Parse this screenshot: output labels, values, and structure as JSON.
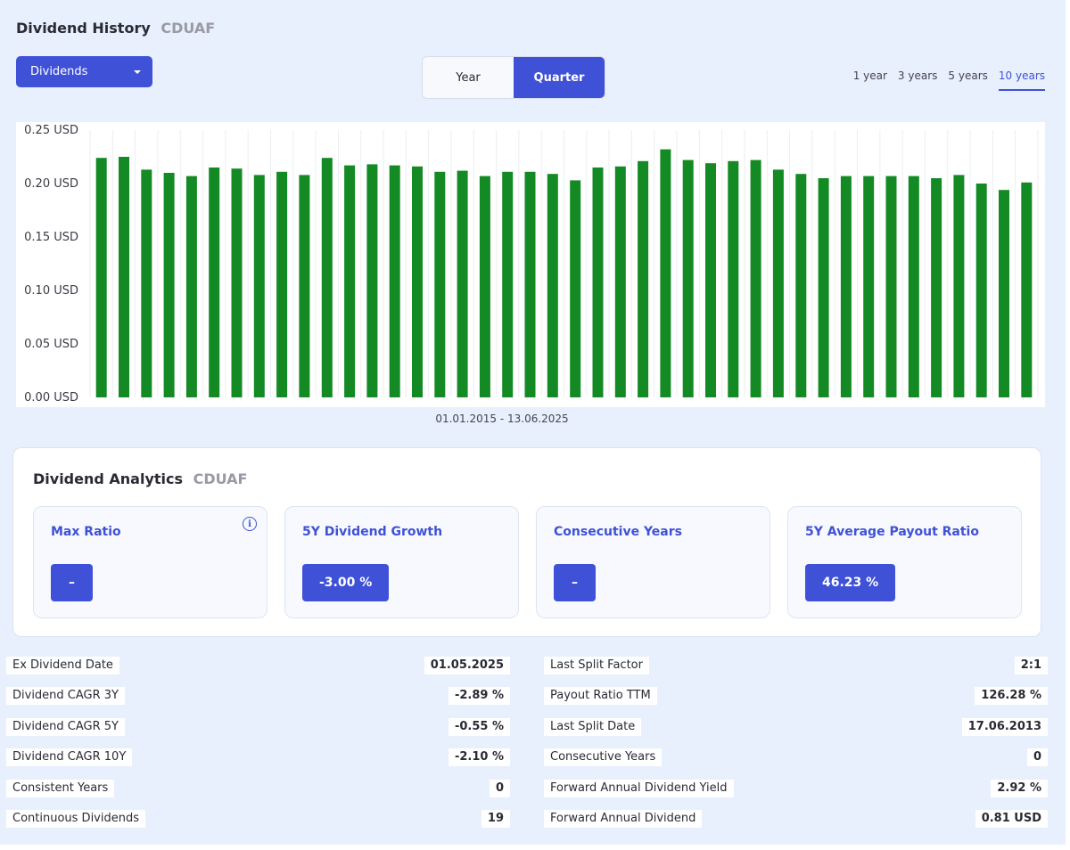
{
  "header": {
    "title": "Dividend History",
    "ticker": "CDUAF",
    "dropdown_value": "Dividends",
    "toggle": {
      "year": "Year",
      "quarter": "Quarter",
      "selected": "Quarter"
    },
    "ranges": [
      "1 year",
      "3 years",
      "5 years",
      "10 years"
    ],
    "active_range": "10 years"
  },
  "chart_data": {
    "type": "bar",
    "title": "",
    "xlabel": "01.01.2015 - 13.06.2025",
    "ylabel": "",
    "ylim": [
      0,
      0.25
    ],
    "yticks": [
      "0.25 USD",
      "0.20 USD",
      "0.15 USD",
      "0.10 USD",
      "0.05 USD",
      "0.00 USD"
    ],
    "ytick_values": [
      0.25,
      0.2,
      0.15,
      0.1,
      0.05,
      0.0
    ],
    "grid": true,
    "color": "#148a24",
    "values": [
      0.224,
      0.225,
      0.213,
      0.21,
      0.207,
      0.215,
      0.214,
      0.208,
      0.211,
      0.208,
      0.224,
      0.217,
      0.218,
      0.217,
      0.216,
      0.211,
      0.212,
      0.207,
      0.211,
      0.211,
      0.209,
      0.203,
      0.215,
      0.216,
      0.221,
      0.232,
      0.222,
      0.219,
      0.221,
      0.222,
      0.213,
      0.209,
      0.205,
      0.207,
      0.207,
      0.207,
      0.207,
      0.205,
      0.208,
      0.2,
      0.194,
      0.201
    ]
  },
  "analytics": {
    "heading": "Dividend Analytics",
    "ticker": "CDUAF",
    "metrics": [
      {
        "label": "Max Ratio",
        "value": "–"
      },
      {
        "label": "5Y Dividend Growth",
        "value": "-3.00 %"
      },
      {
        "label": "Consecutive Years",
        "value": "–"
      },
      {
        "label": "5Y Average Payout Ratio",
        "value": "46.23 %"
      }
    ],
    "info_glyph": "i"
  },
  "stats": {
    "left": [
      {
        "label": "Ex Dividend Date",
        "value": "01.05.2025"
      },
      {
        "label": "Dividend CAGR 3Y",
        "value": "-2.89 %"
      },
      {
        "label": "Dividend CAGR 5Y",
        "value": "-0.55 %"
      },
      {
        "label": "Dividend CAGR 10Y",
        "value": "-2.10 %"
      },
      {
        "label": "Consistent Years",
        "value": "0"
      },
      {
        "label": "Continuous Dividends",
        "value": "19"
      }
    ],
    "right": [
      {
        "label": "Last Split Factor",
        "value": "2:1"
      },
      {
        "label": "Payout Ratio TTM",
        "value": "126.28 %"
      },
      {
        "label": "Last Split Date",
        "value": "17.06.2013"
      },
      {
        "label": "Consecutive Years",
        "value": "0"
      },
      {
        "label": "Forward Annual Dividend Yield",
        "value": "2.92 %"
      },
      {
        "label": "Forward Annual Dividend",
        "value": "0.81 USD"
      }
    ]
  }
}
